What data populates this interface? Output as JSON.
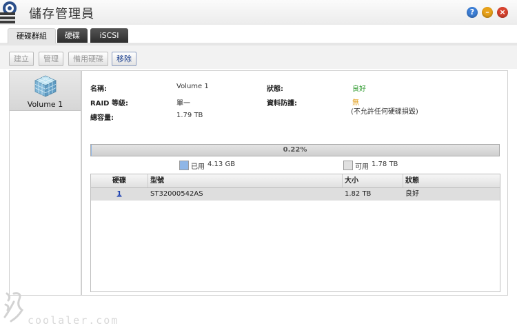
{
  "window": {
    "title": "儲存管理員"
  },
  "title_buttons": {
    "help": "?",
    "minimize": "–",
    "close": "×"
  },
  "tabs": [
    {
      "label": "硬碟群組"
    },
    {
      "label": "硬碟"
    },
    {
      "label": "iSCSI"
    }
  ],
  "toolbar": {
    "create": "建立",
    "manage": "管理",
    "spare": "備用硬碟",
    "remove": "移除"
  },
  "volumes": [
    {
      "label": "Volume 1"
    }
  ],
  "details": {
    "name_label": "名稱:",
    "name_value": "Volume 1",
    "raid_label": "RAID 等級:",
    "raid_value": "單一",
    "total_label": "總容量:",
    "total_value": "1.79 TB",
    "status_label": "狀態:",
    "status_value": "良好",
    "protection_label": "資料防護:",
    "protection_value": "無",
    "protection_note": "(不允許任何硬碟損毀)"
  },
  "usage": {
    "percent_text": "0.22%",
    "percent_value": 0.22,
    "used_label": "已用",
    "used_value": "4.13 GB",
    "free_label": "可用",
    "free_value": "1.78 TB",
    "used_color": "#8fb6e6",
    "free_color": "#e0e0e0"
  },
  "disk_table": {
    "headers": {
      "disk": "硬碟",
      "model": "型號",
      "size": "大小",
      "status": "狀態"
    },
    "rows": [
      {
        "disk": "1",
        "model": "ST32000542AS",
        "size": "1.82 TB",
        "status": "良好"
      }
    ]
  },
  "watermark": {
    "text": "coolaler.com"
  },
  "colors": {
    "good": "#2e9a2e",
    "none": "#e09a12",
    "link": "#1a3fb0"
  }
}
